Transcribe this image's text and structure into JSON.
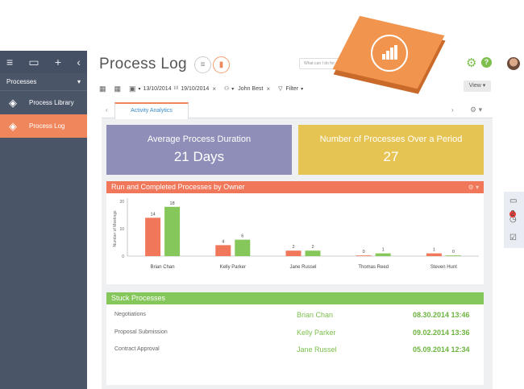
{
  "sidebar": {
    "selector_label": "Processes",
    "items": [
      {
        "label": "Process Library",
        "icon": "process-library-icon"
      },
      {
        "label": "Process Log",
        "icon": "process-log-icon"
      }
    ]
  },
  "header": {
    "title": "Process Log",
    "search_placeholder": "What can I do for you?",
    "view_label": "View"
  },
  "filters": {
    "date_from": "13/10/2014",
    "till": "till",
    "date_to": "19/10/2014",
    "owner": "John Best",
    "filter_label": "Filter"
  },
  "tabs": [
    {
      "label": "Activity Analytics"
    }
  ],
  "cards": [
    {
      "label": "Average Process Duration",
      "value": "21 Days"
    },
    {
      "label": "Number of Processes Over a Period",
      "value": "27"
    }
  ],
  "chart_section_title": "Run and Completed Processes by Owner",
  "chart_data": {
    "type": "bar",
    "ylabel": "Number of Meetings",
    "ylim": [
      0,
      20
    ],
    "yticks": [
      0,
      10,
      20
    ],
    "categories": [
      "Brian Chan",
      "Kelly Parker",
      "Jane Russel",
      "Thomas Reed",
      "Steven Hunt"
    ],
    "series": [
      {
        "values": [
          14,
          4,
          2,
          0,
          1
        ],
        "color": "#f0775a"
      },
      {
        "values": [
          18,
          6,
          2,
          1,
          0
        ],
        "color": "#85c75a"
      }
    ]
  },
  "stuck": {
    "title": "Stuck Processes",
    "rows": [
      {
        "name": "Negotiations",
        "owner": "Brian Chan",
        "date": "08.30.2014 13:46"
      },
      {
        "name": "Proposal Submission",
        "owner": "Kelly Parker",
        "date": "09.02.2014 13:36"
      },
      {
        "name": "Contract Approval",
        "owner": "Jane Russel",
        "date": "05.09.2014 12:34"
      }
    ]
  },
  "right_toolbar": {
    "notification_count": "2"
  },
  "colors": {
    "accent": "#f0875c",
    "green": "#85c75a",
    "purple": "#8e8eb8",
    "yellow": "#e6c454"
  }
}
